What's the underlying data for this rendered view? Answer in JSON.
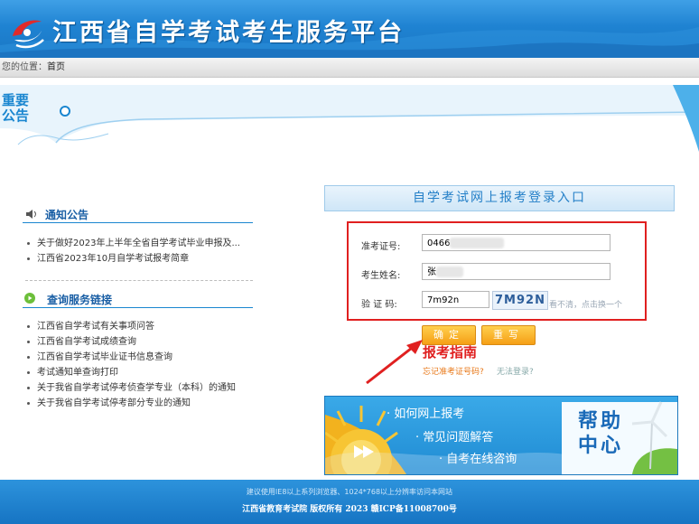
{
  "header": {
    "title": "江西省自学考试考生服务平台"
  },
  "breadcrumb": {
    "prefix": "您的位置：",
    "current": "首页"
  },
  "banner": {
    "label": "重要公告"
  },
  "notices": {
    "title": "通知公告",
    "items": [
      "关于做好2023年上半年全省自学考试毕业申报及...",
      "江西省2023年10月自学考试报考简章"
    ]
  },
  "links": {
    "title": "查询服务链接",
    "items": [
      "江西省自学考试有关事项问答",
      "江西省自学考试成绩查询",
      "江西省自学考试毕业证书信息查询",
      "考试通知单查询打印",
      "关于我省自学考试停考侦查学专业（本科）的通知",
      "关于我省自学考试停考部分专业的通知"
    ]
  },
  "login": {
    "title": "自学考试网上报考登录入口",
    "ticket_label": "准考证号:",
    "ticket_value": "0466",
    "name_label": "考生姓名:",
    "name_value": "张",
    "captcha_label": "验 证 码:",
    "captcha_value": "7m92n",
    "captcha_image_text": "7M92N",
    "captcha_hint": "看不清，点击换一个",
    "confirm_label": "确定",
    "reset_label": "重写",
    "forgot_label": "忘记准考证号码?",
    "cant_login_label": "无法登录?"
  },
  "annotation": {
    "text": "报考指南",
    "color": "#e02020"
  },
  "help": {
    "items": [
      "如何网上报考",
      "常见问题解答",
      "自考在线咨询"
    ],
    "title": "帮助中心"
  },
  "footer": {
    "note": "建议使用IE8以上系列浏览器、1024*768以上分辨率访问本网站",
    "copyright": "江西省教育考试院 版权所有 2023 赣ICP备11008700号"
  },
  "colors": {
    "primary": "#1a86d0",
    "accent": "#f59f16",
    "alert": "#e02020"
  }
}
